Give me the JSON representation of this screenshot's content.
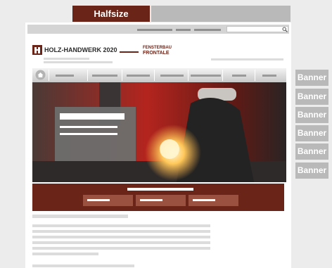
{
  "tabs": {
    "halfsize_label": "Halfsize"
  },
  "header": {
    "logo_text": "HOLZ-HANDWERK 2020",
    "partner_logo_line1": "FENSTERBAU",
    "partner_logo_line2": "FRONTALE"
  },
  "banners": [
    "Banner",
    "Banner",
    "Banner",
    "Banner",
    "Banner",
    "Banner"
  ],
  "colors": {
    "brand": "#6b2418",
    "placeholder_grey": "#b9b9b9",
    "hero_overlay": "#6e6e6e"
  },
  "icons": {
    "search": "search-icon",
    "home": "home-icon"
  }
}
